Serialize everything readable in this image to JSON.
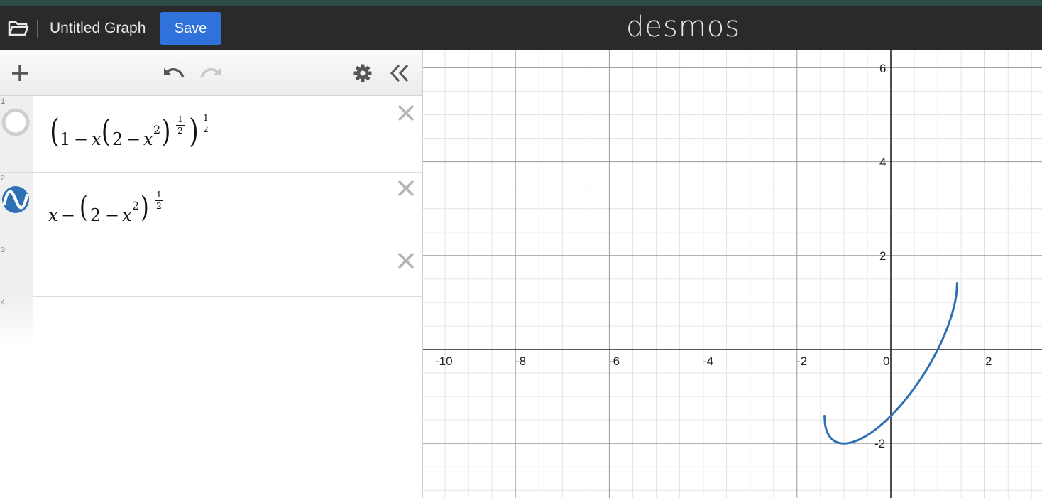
{
  "header": {
    "title": "Untitled Graph",
    "save_label": "Save",
    "logo": "desmos"
  },
  "toolbar": {
    "icons": [
      "plus-icon",
      "undo-icon",
      "redo-icon",
      "gear-icon",
      "double-chevron-left-icon"
    ]
  },
  "expressions": [
    {
      "index": "1",
      "icon": "hidden-circle-icon",
      "latex_parts": {
        "one": "1",
        "minus1": "−",
        "x": "x",
        "two": "2",
        "minus2": "−",
        "x2": "x",
        "sup2": "2",
        "half_num_inner": "1",
        "half_den_inner": "2",
        "half_num_outer": "1",
        "half_den_outer": "2"
      }
    },
    {
      "index": "2",
      "icon": "wave-graph-icon",
      "color": "#2d70b3",
      "latex_parts": {
        "x": "x",
        "minus1": "−",
        "two": "2",
        "minus2": "−",
        "x2": "x",
        "sup2": "2",
        "half_num": "1",
        "half_den": "2"
      }
    },
    {
      "index": "3"
    },
    {
      "index": "4"
    }
  ],
  "graph": {
    "x_ticks": [
      "-10",
      "-8",
      "-6",
      "-4",
      "-2",
      "0",
      "2"
    ],
    "y_ticks": [
      "6",
      "4",
      "2",
      "-2"
    ],
    "curve_color": "#2d70b3"
  }
}
